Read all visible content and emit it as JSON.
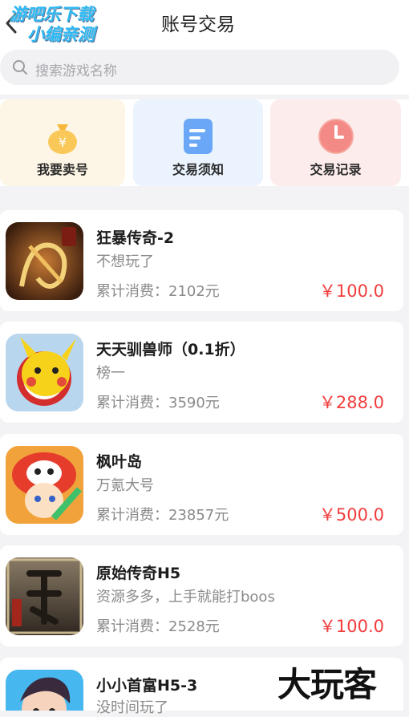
{
  "header": {
    "title": "账号交易",
    "watermark_line1": "游吧乐下载",
    "watermark_line2": "小编亲测"
  },
  "search": {
    "placeholder": "搜索游戏名称"
  },
  "actions": [
    {
      "label": "我要卖号",
      "icon": "money-bag-icon",
      "bg": "#fdf6e6",
      "accent": "#f7c24d"
    },
    {
      "label": "交易须知",
      "icon": "notice-document-icon",
      "bg": "#eaf3fe",
      "accent": "#5b9ef5"
    },
    {
      "label": "交易记录",
      "icon": "clock-record-icon",
      "bg": "#fdecec",
      "accent": "#f37b7b"
    }
  ],
  "listings": [
    {
      "name": "狂暴传奇-2",
      "desc": "不想玩了",
      "spend": "累计消费：2102元",
      "price": "￥100.0"
    },
    {
      "name": "天天驯兽师（0.1折）",
      "desc": "榜一",
      "spend": "累计消费：3590元",
      "price": "￥288.0"
    },
    {
      "name": "枫叶岛",
      "desc": "万氪大号",
      "spend": "累计消费：23857元",
      "price": "￥500.0"
    },
    {
      "name": "原始传奇H5",
      "desc": "资源多多，上手就能打boos",
      "spend": "累计消费：2528元",
      "price": "￥100.0"
    },
    {
      "name": "小小首富H5-3",
      "desc": "没时间玩了",
      "spend": "",
      "price": ""
    }
  ],
  "watermark_bottom": "大玩客",
  "colors": {
    "price": "#f23c3c",
    "page_bg": "#f3f3f5"
  }
}
